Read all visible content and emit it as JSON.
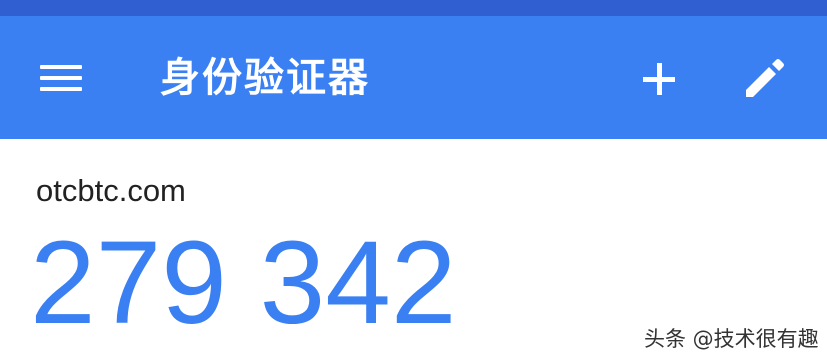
{
  "colors": {
    "status_bar": "#2f5fd0",
    "app_bar": "#3a80f2",
    "code": "#3a80f2",
    "issuer": "#222222",
    "background": "#ffffff"
  },
  "app_bar": {
    "title": "身份验证器",
    "menu_icon": "menu-icon",
    "add_icon": "plus-icon",
    "edit_icon": "pencil-icon"
  },
  "accounts": [
    {
      "issuer": "otcbtc.com",
      "code": "279 342"
    }
  ],
  "watermark": "头条 @技术很有趣"
}
